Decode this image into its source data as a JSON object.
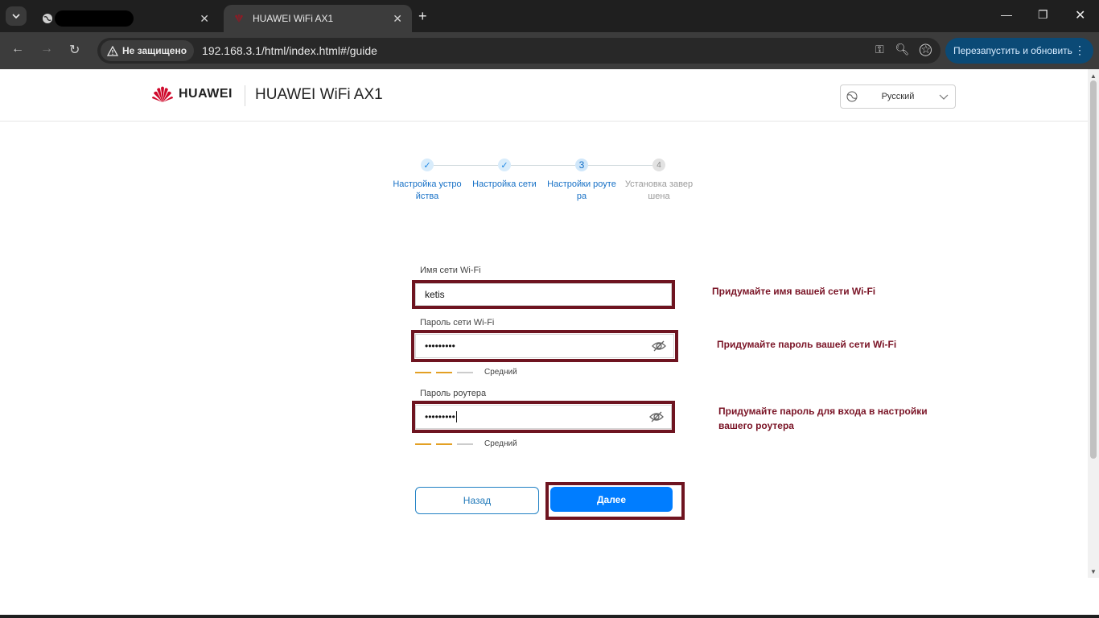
{
  "browser": {
    "tabs": [
      {
        "label": "",
        "active": false
      },
      {
        "label": "HUAWEI WiFi AX1",
        "active": true
      }
    ],
    "security_label": "Не защищено",
    "url": "192.168.3.1/html/index.html#/guide",
    "relaunch_label": "Перезапустить и обновить"
  },
  "header": {
    "brand": "HUAWEI",
    "product": "HUAWEI WiFi AX1",
    "language": "Русский"
  },
  "stepper": {
    "steps": [
      {
        "number": "✓",
        "label": "Настройка устро йства",
        "state": "done"
      },
      {
        "number": "✓",
        "label": "Настройка сети",
        "state": "done"
      },
      {
        "number": "3",
        "label": "Настройки роуте ра",
        "state": "active"
      },
      {
        "number": "4",
        "label": "Установка завер шена",
        "state": "pending"
      }
    ]
  },
  "form": {
    "wifi_name_label": "Имя сети Wi-Fi",
    "wifi_name_value": "ketis",
    "wifi_password_label": "Пароль сети Wi-Fi",
    "wifi_password_value": "•••••••••",
    "wifi_password_strength": "Средний",
    "router_password_label": "Пароль роутера",
    "router_password_value": "•••••••••",
    "router_password_strength": "Средний",
    "back_label": "Назад",
    "next_label": "Далее"
  },
  "annotations": {
    "wifi_name_hint": "Придумайте имя вашей сети Wi-Fi",
    "wifi_password_hint": "Придумайте пароль вашей сети Wi-Fi",
    "router_password_hint_line1": "Придумайте пароль для входа в настройки",
    "router_password_hint_line2": "вашего роутера"
  },
  "colors": {
    "accent": "#007dff",
    "annotation": "#6e1420",
    "strength": "#e3a024",
    "brand_red": "#cf0a2c"
  },
  "icons": [
    "tab-list-icon",
    "globe-icon",
    "close-icon",
    "plus-icon",
    "minimize-icon",
    "restore-icon",
    "back-icon",
    "forward-icon",
    "reload-icon",
    "warning-icon",
    "key-icon",
    "zoom-icon",
    "star-icon",
    "profile-icon",
    "more-icon",
    "huawei-logo-icon",
    "language-globe-icon",
    "chevron-down-icon",
    "check-icon",
    "eye-off-icon"
  ]
}
